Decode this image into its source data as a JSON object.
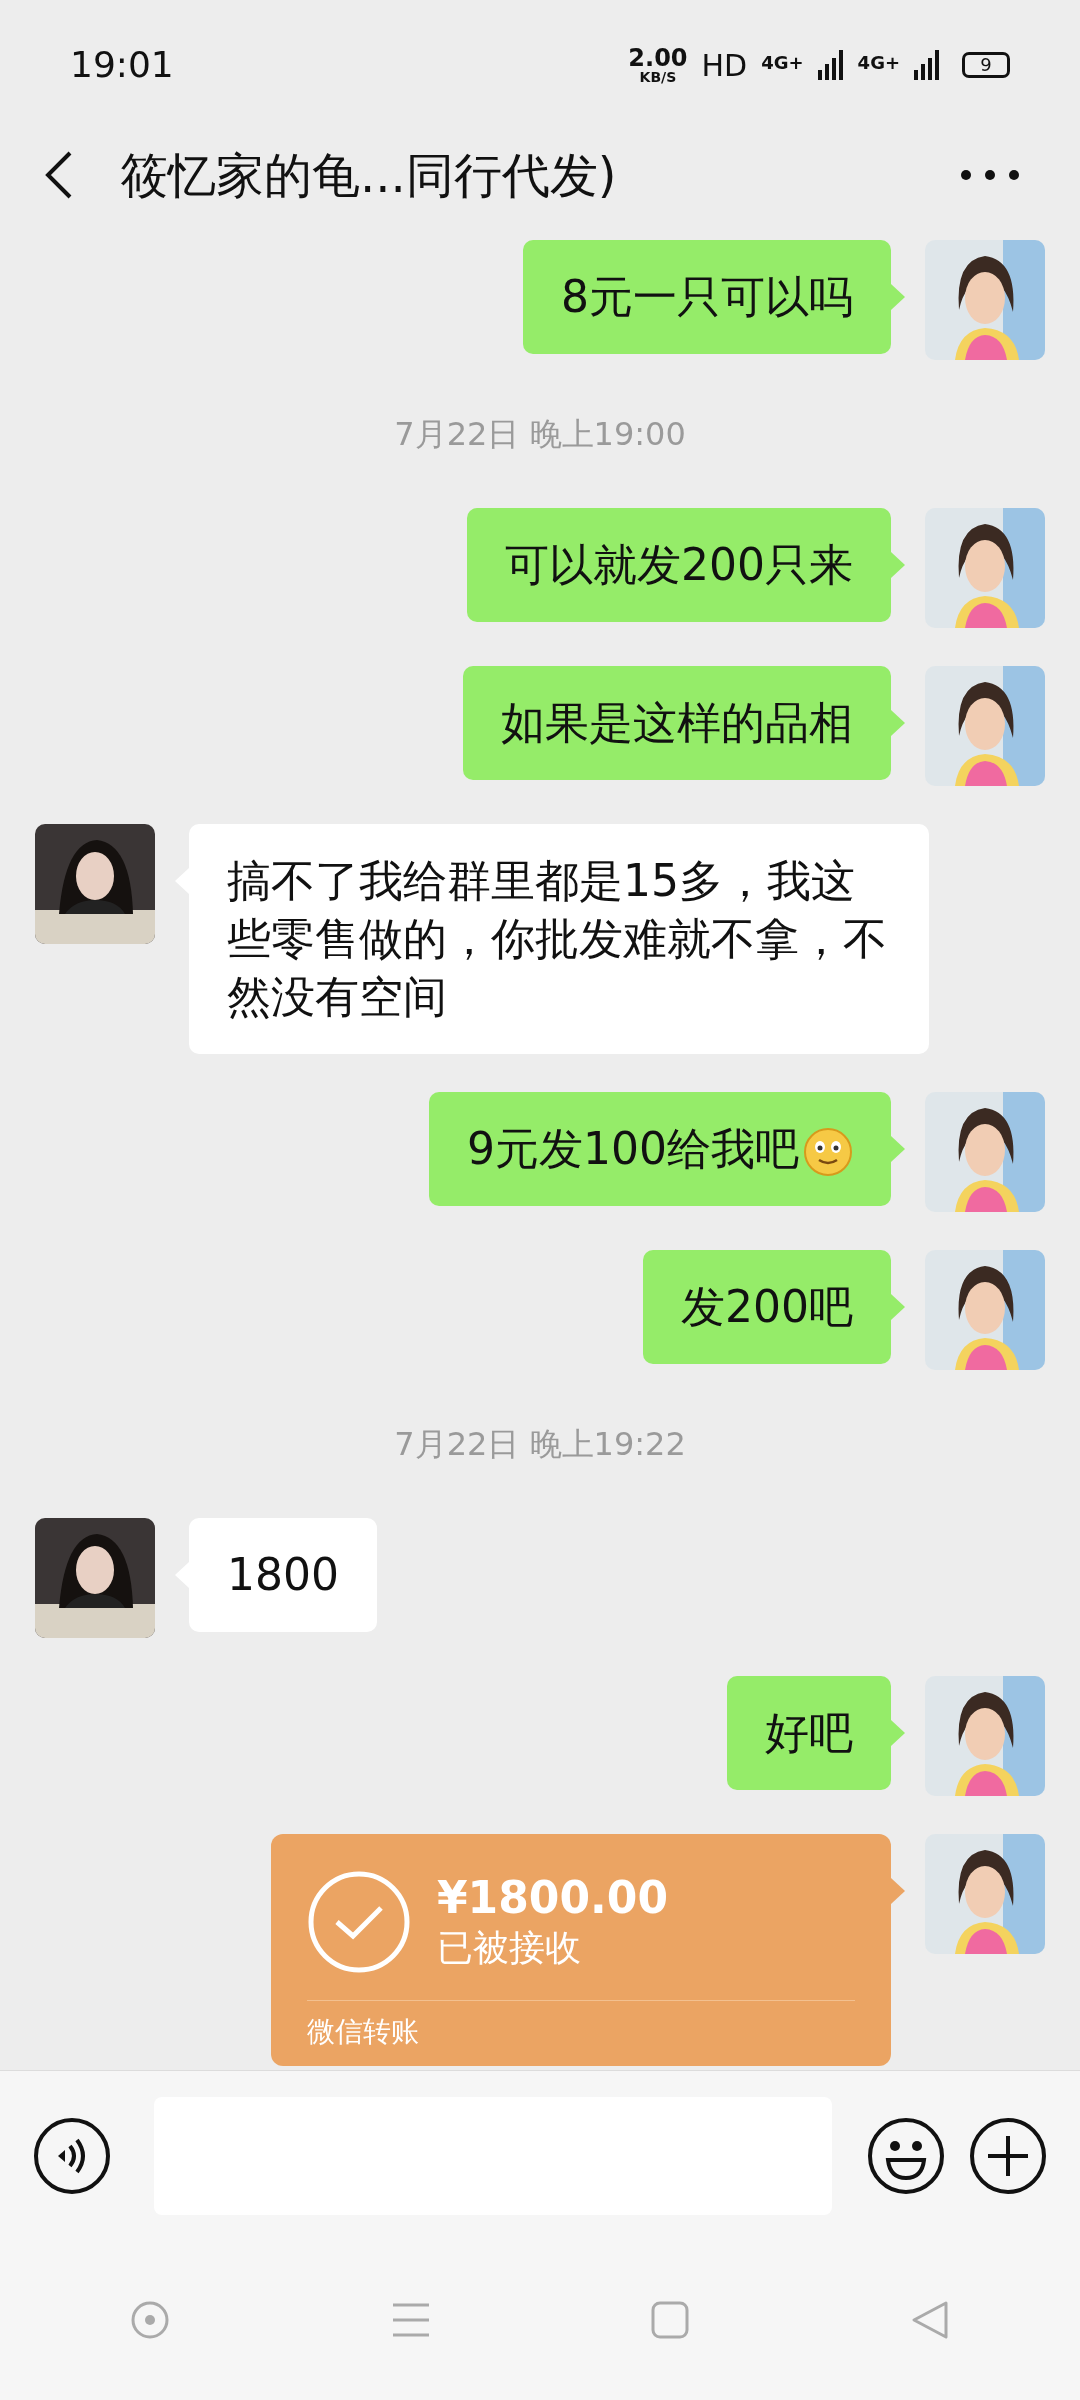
{
  "status_bar": {
    "time": "19:01",
    "speed": "2.00",
    "speed_unit": "KB/S",
    "hd": "HD",
    "network_1": "4G+",
    "network_2": "4G+",
    "battery": "9"
  },
  "header": {
    "title": "筱忆家的龟...同行代发)"
  },
  "messages": [
    {
      "kind": "text",
      "outgoing": true,
      "text": "8元一只可以吗"
    },
    {
      "kind": "time",
      "text": "7月22日 晚上19:00"
    },
    {
      "kind": "text",
      "outgoing": true,
      "text": "可以就发200只来"
    },
    {
      "kind": "text",
      "outgoing": true,
      "text": "如果是这样的品相"
    },
    {
      "kind": "text",
      "outgoing": false,
      "text": "搞不了我给群里都是15多，我这些零售做的，你批发难就不拿，不然没有空间"
    },
    {
      "kind": "text",
      "outgoing": true,
      "text": "9元发100给我吧",
      "emoji": true
    },
    {
      "kind": "text",
      "outgoing": true,
      "text": "发200吧"
    },
    {
      "kind": "time",
      "text": "7月22日 晚上19:22"
    },
    {
      "kind": "text",
      "outgoing": false,
      "text": "1800"
    },
    {
      "kind": "text",
      "outgoing": true,
      "text": "好吧"
    },
    {
      "kind": "transfer",
      "outgoing": true,
      "amount": "¥1800.00",
      "status": "已被接收",
      "footer": "微信转账"
    }
  ]
}
